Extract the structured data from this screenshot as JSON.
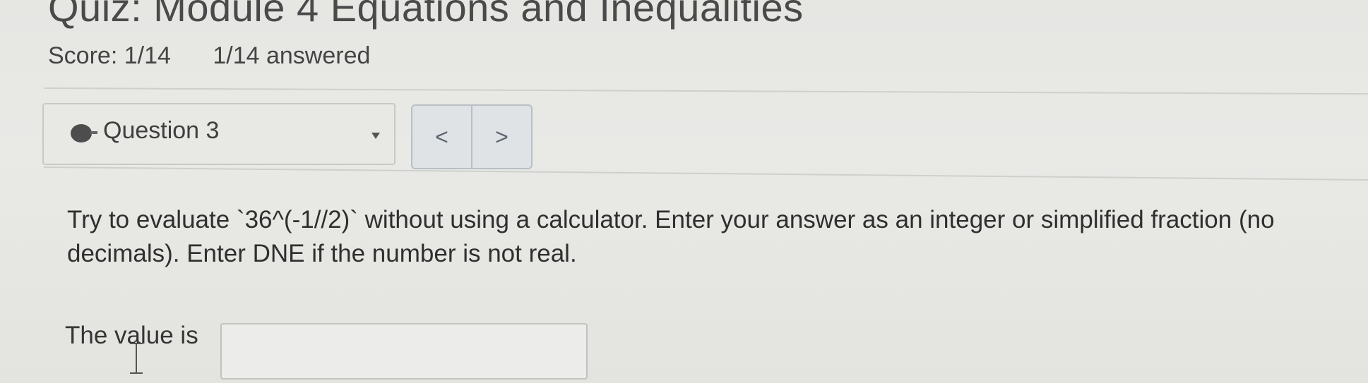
{
  "quiz": {
    "title": "Quiz: Module 4 Equations and Inequalities",
    "score": "Score: 1/14",
    "answered": "1/14 answered"
  },
  "question_nav": {
    "selected_label": "Question 3",
    "prev_symbol": "<",
    "next_symbol": ">"
  },
  "question": {
    "prompt": "Try to evaluate `36^(-1//2)` without using a calculator. Enter your answer as an integer or simplified fraction (no decimals). Enter DNE if the number is not real.",
    "answer_label": "The value is",
    "answer_value": ""
  },
  "icons": {
    "status": "status-dot-icon",
    "dropdown": "caret-down-icon",
    "cursor": "text-cursor-icon"
  }
}
